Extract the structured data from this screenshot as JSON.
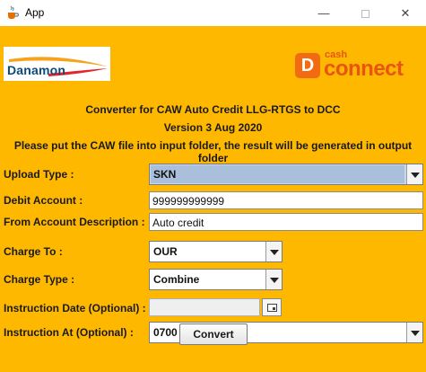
{
  "window": {
    "title": "App",
    "minimize_glyph": "—",
    "close_glyph": "✕"
  },
  "logos": {
    "danamon": "Danamon",
    "cash_connect_d": "D",
    "cash_connect_top": "cash",
    "cash_connect_bottom": "connect"
  },
  "header": {
    "title": "Converter for CAW Auto Credit LLG-RTGS to DCC",
    "version": "Version 3 Aug 2020",
    "instruction": "Please put the CAW file into input folder, the result will be generated in output folder"
  },
  "form": {
    "upload_type": {
      "label": "Upload Type :",
      "value": "SKN"
    },
    "debit_account": {
      "label": "Debit Account :",
      "value": "999999999999"
    },
    "from_account_description": {
      "label": "From Account Description :",
      "value": "Auto credit"
    },
    "charge_to": {
      "label": "Charge To :",
      "value": "OUR"
    },
    "charge_type": {
      "label": "Charge Type :",
      "value": "Combine"
    },
    "instruction_date": {
      "label": "Instruction Date (Optional) :",
      "value": ""
    },
    "instruction_at": {
      "label": "Instruction At (Optional) :",
      "value": "0700"
    }
  },
  "actions": {
    "convert_label": "Convert"
  },
  "colors": {
    "background": "#ffb800",
    "brand_orange": "#f26a12",
    "danamon_blue": "#0c4a7a"
  }
}
